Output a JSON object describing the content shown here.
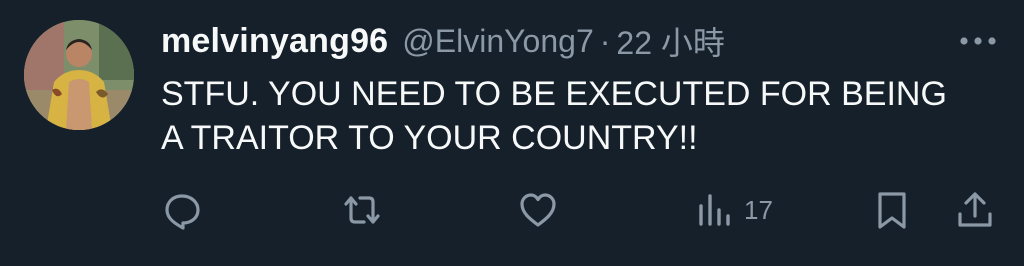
{
  "tweet": {
    "display_name": "melvinyang96",
    "handle": "@ElvinYong7",
    "separator": "·",
    "time": "22 小時",
    "text_lines": [
      "STFU. YOU NEED TO BE EXECUTED FOR BEING",
      "A TRAITOR TO YOUR COUNTRY!!"
    ]
  },
  "actions": {
    "views_count": "17"
  },
  "icons": {
    "more": "more-horizontal-icon",
    "reply": "reply-icon",
    "retweet": "retweet-icon",
    "like": "heart-icon",
    "views": "views-chart-icon",
    "bookmark": "bookmark-icon",
    "share": "share-icon"
  },
  "colors": {
    "background": "#15202b",
    "text": "#f7f9f9",
    "muted": "#8b98a5"
  }
}
